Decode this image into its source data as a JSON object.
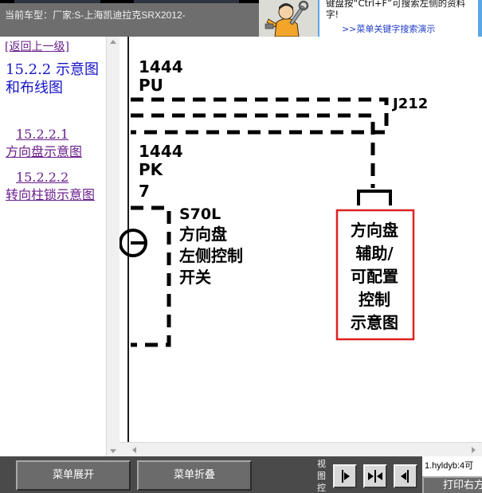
{
  "header": {
    "vehicle_label": "当前车型：厂家:S-上海凯迪拉克SRX2012-",
    "hint_text": "键盘按“Ctrl+F”可搜索左侧的资料字!",
    "search_demo_link": ">>菜单关键字搜索演示"
  },
  "nav": {
    "back_link": "[返回上一级]",
    "section_title": "15.2.2 示意图和布线图",
    "items": [
      {
        "number": "15.2.2.1",
        "title": "方向盘示意图"
      },
      {
        "number": "15.2.2.2",
        "title": "转向柱锁示意图"
      }
    ]
  },
  "diagram": {
    "wire_1_code": "1444",
    "wire_1_color": "PU",
    "connector_j212": "J212",
    "wire_2_code": "1444",
    "wire_2_color": "PK",
    "wire_2_pin": "7",
    "switch_code": "S70L",
    "switch_name_line1": "方向盘",
    "switch_name_line2": "左侧控制",
    "switch_name_line3": "开关",
    "module_line1": "方向盘",
    "module_line2": "辅助/",
    "module_line3": "可配置",
    "module_line4": "控制",
    "module_line5": "示意图",
    "highlight_color": "#e02020"
  },
  "toolbar": {
    "expand_label": "菜单展开",
    "collapse_label": "菜单折叠",
    "view_control_label": "视图控",
    "page_info": "1.hyldyb:4可",
    "print_label": "打印右方"
  },
  "icons": {
    "view_btn_right": "arrow-right-icon",
    "view_btn_center": "arrows-inward-icon",
    "view_btn_left": "arrow-left-icon"
  }
}
